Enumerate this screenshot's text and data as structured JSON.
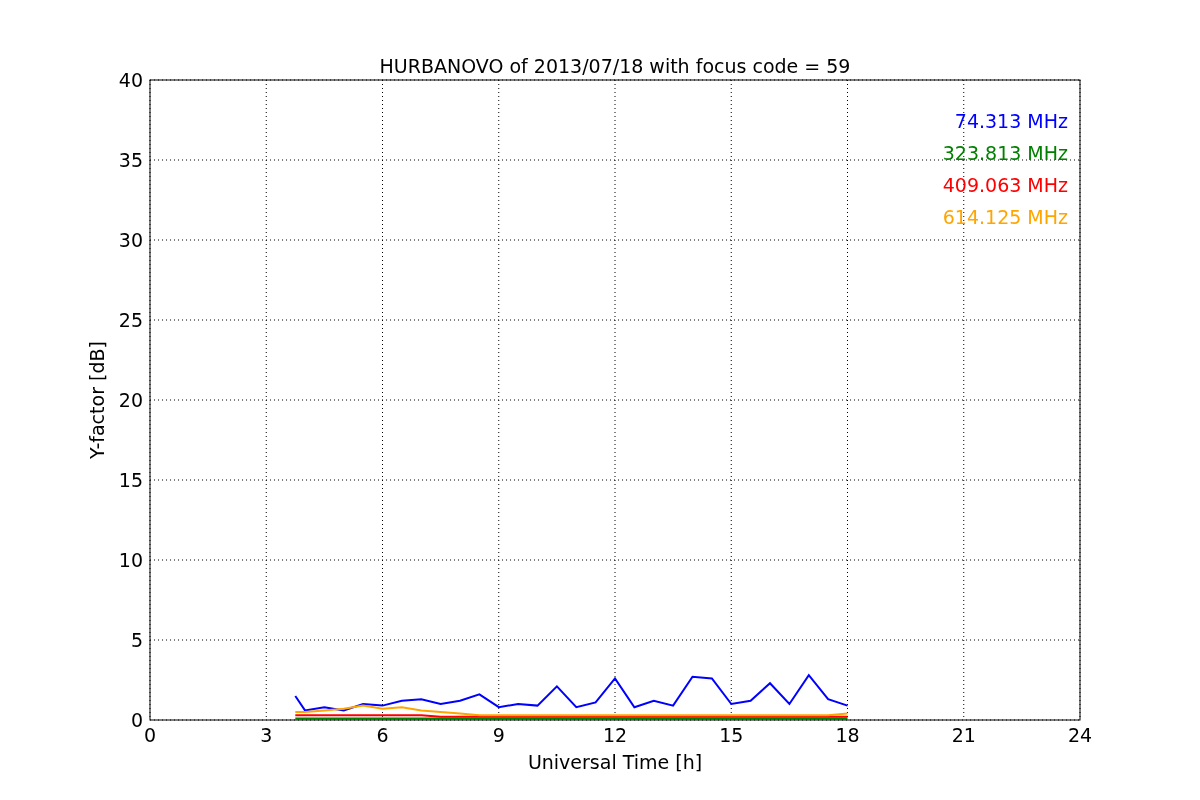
{
  "figure": {
    "chart_data": {
      "type": "line",
      "title": "HURBANOVO of 2013/07/18 with focus code = 59",
      "xlabel": "Universal Time [h]",
      "ylabel": "Y-factor [dB]",
      "x": [
        3.75,
        4,
        4.5,
        5,
        5.5,
        6,
        6.5,
        7,
        7.5,
        8,
        8.5,
        9,
        9.5,
        10,
        10.5,
        11,
        11.5,
        12,
        12.5,
        13,
        13.5,
        14,
        14.5,
        15,
        15.5,
        16,
        16.5,
        17,
        17.5,
        18
      ],
      "series": [
        {
          "name": "74.313 MHz",
          "color": "#0000ff",
          "values": [
            1.5,
            0.6,
            0.8,
            0.6,
            1.0,
            0.9,
            1.2,
            1.3,
            1.0,
            1.2,
            1.6,
            0.8,
            1.0,
            0.9,
            2.1,
            0.8,
            1.1,
            2.6,
            0.8,
            1.2,
            0.9,
            2.7,
            2.6,
            1.0,
            1.2,
            2.3,
            1.0,
            2.8,
            1.3,
            0.9
          ]
        },
        {
          "name": "323.813 MHz",
          "color": "#008000",
          "values": [
            0.1,
            0.1,
            0.1,
            0.1,
            0.1,
            0.1,
            0.1,
            0.1,
            0.1,
            0.1,
            0.1,
            0.1,
            0.1,
            0.1,
            0.1,
            0.1,
            0.1,
            0.1,
            0.1,
            0.1,
            0.1,
            0.1,
            0.1,
            0.1,
            0.1,
            0.1,
            0.1,
            0.1,
            0.1,
            0.1
          ]
        },
        {
          "name": "409.063 MHz",
          "color": "#ff0000",
          "values": [
            0.3,
            0.3,
            0.3,
            0.3,
            0.3,
            0.3,
            0.3,
            0.3,
            0.2,
            0.2,
            0.2,
            0.2,
            0.2,
            0.2,
            0.2,
            0.2,
            0.2,
            0.2,
            0.2,
            0.2,
            0.2,
            0.2,
            0.2,
            0.2,
            0.2,
            0.2,
            0.2,
            0.2,
            0.2,
            0.2
          ]
        },
        {
          "name": "614.125 MHz",
          "color": "#ffa500",
          "values": [
            0.5,
            0.5,
            0.6,
            0.7,
            0.9,
            0.7,
            0.8,
            0.6,
            0.5,
            0.4,
            0.3,
            0.3,
            0.3,
            0.3,
            0.3,
            0.3,
            0.3,
            0.3,
            0.3,
            0.3,
            0.3,
            0.3,
            0.3,
            0.3,
            0.3,
            0.3,
            0.3,
            0.3,
            0.3,
            0.4
          ]
        }
      ],
      "grid": true,
      "xlim": [
        0,
        24
      ],
      "ylim": [
        0,
        40
      ],
      "xticks": [
        0,
        3,
        6,
        9,
        12,
        15,
        18,
        21,
        24
      ],
      "yticks": [
        0,
        5,
        10,
        15,
        20,
        25,
        30,
        35,
        40
      ]
    }
  }
}
